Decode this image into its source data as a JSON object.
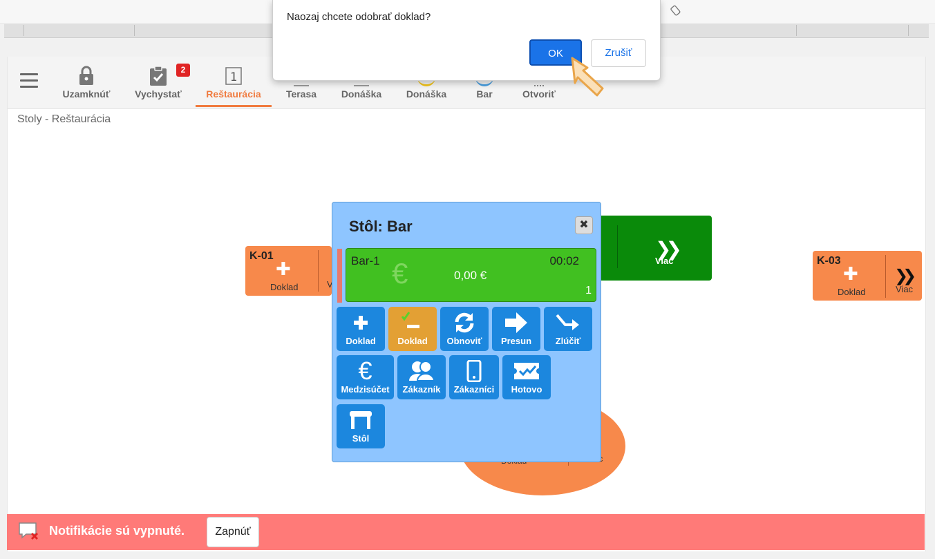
{
  "dialog": {
    "message": "Naozaj chcete odobrať doklad?",
    "ok_label": "OK",
    "cancel_label": "Zrušiť"
  },
  "toolbar": {
    "items": [
      {
        "label": "Uzamknúť",
        "icon": "lock-icon"
      },
      {
        "label": "Vychystať",
        "icon": "clipboard-check-icon",
        "badge": "2"
      },
      {
        "label": "Reštaurácia",
        "icon": "number-1-icon",
        "icon_text": "1",
        "active": true
      },
      {
        "label": "Terasa",
        "icon": "terrace-icon"
      },
      {
        "label": "Donáška",
        "icon": "delivery-icon"
      },
      {
        "label": "Donáška",
        "icon": "delivery-circle-icon"
      },
      {
        "label": "Bar",
        "icon": "bar-icon"
      },
      {
        "label": "Otvoriť",
        "icon": "open-icon"
      }
    ]
  },
  "page_title": "Stoly - Reštaurácia",
  "tables": {
    "k01": {
      "code": "K-01",
      "doc_label": "Doklad",
      "more_label": "V"
    },
    "k03": {
      "code": "K-03",
      "doc_label": "Doklad",
      "more_label": "Viac"
    },
    "green": {
      "more_label": "Viac"
    },
    "ellipse": {
      "doc_label": "Doklad",
      "more_label": "iac"
    }
  },
  "popup": {
    "title": "Stôl: Bar",
    "document": {
      "name": "Bar-1",
      "time": "00:02",
      "amount": "0,00 €",
      "count": "1"
    },
    "actions": [
      {
        "label": "Doklad",
        "icon": "plus-icon"
      },
      {
        "label": "Doklad",
        "icon": "minus-icon"
      },
      {
        "label": "Obnoviť",
        "icon": "refresh-icon"
      },
      {
        "label": "Presun",
        "icon": "arrow-right-icon"
      },
      {
        "label": "Zlúčiť",
        "icon": "merge-icon"
      },
      {
        "label": "Medzisúčet",
        "icon": "euro-icon"
      },
      {
        "label": "Zákazník",
        "icon": "users-icon"
      },
      {
        "label": "Zákazníci",
        "icon": "phone-icon"
      },
      {
        "label": "Hotovo",
        "icon": "ticket-check-icon"
      },
      {
        "label": "Stôl",
        "icon": "table-icon"
      }
    ]
  },
  "notification": {
    "text": "Notifikácie sú vypnuté.",
    "button_label": "Zapnúť"
  },
  "colors": {
    "accent": "#f07b3f",
    "action_blue": "#1c87de",
    "popup_bg": "#8ec5ff",
    "doc_green": "#41c021",
    "notif_red": "#ff7a78"
  }
}
